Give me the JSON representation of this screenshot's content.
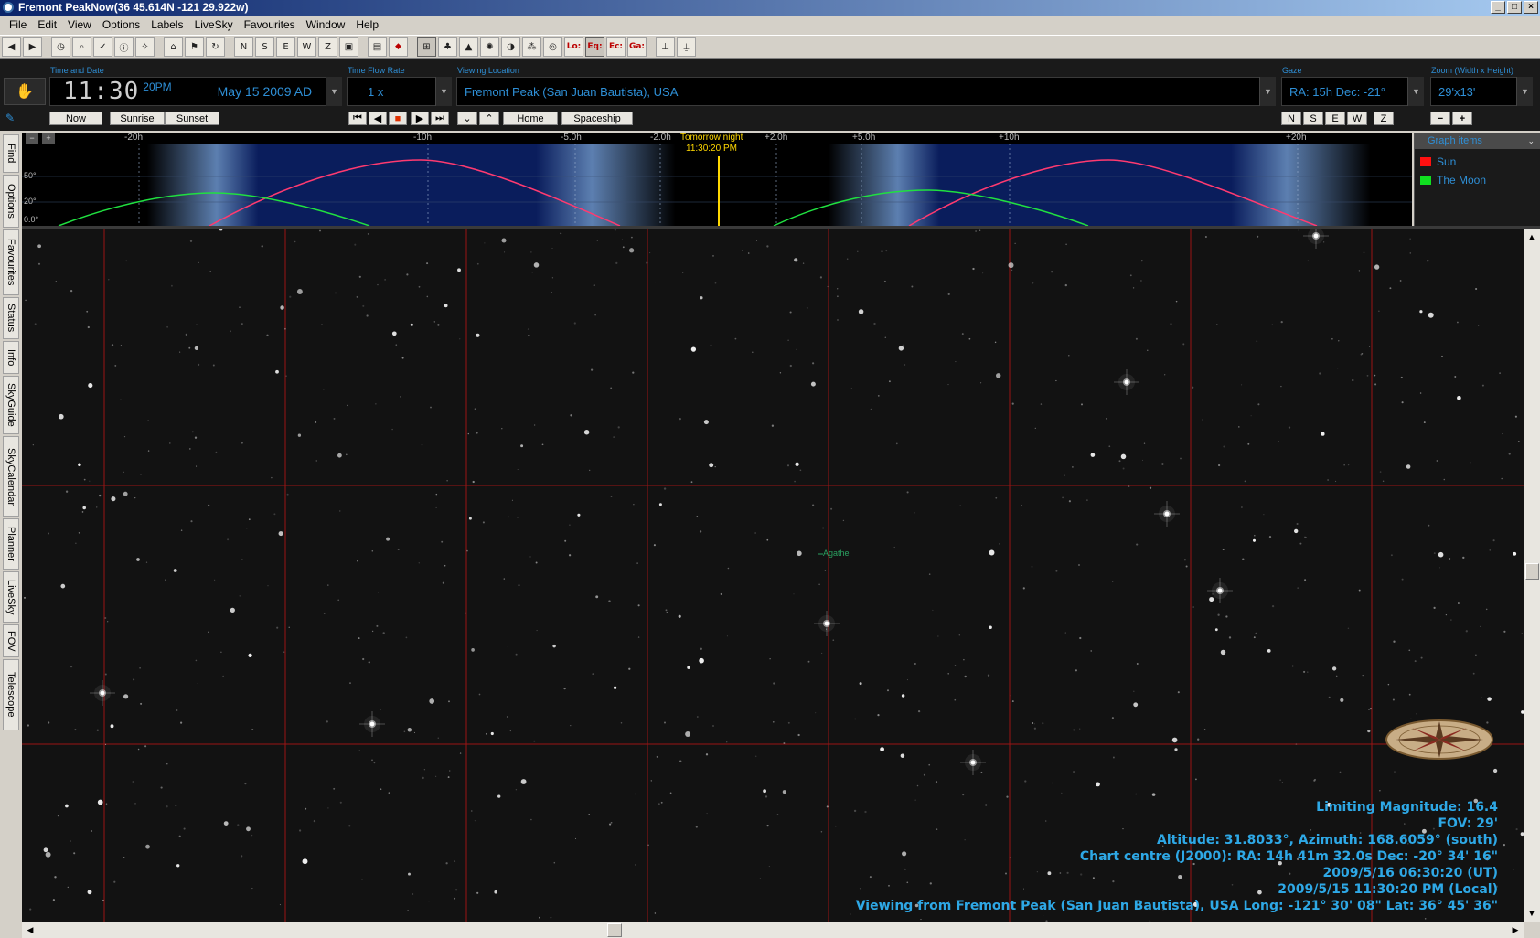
{
  "window": {
    "title": "Fremont PeakNow(36  45.614N -121 29.922w)"
  },
  "menu": [
    "File",
    "Edit",
    "View",
    "Options",
    "Labels",
    "LiveSky",
    "Favourites",
    "Window",
    "Help"
  ],
  "toolbar": {
    "buttons": [
      {
        "icon": "back-arrow-icon",
        "glyph": "◀"
      },
      {
        "icon": "forward-arrow-icon",
        "glyph": "▶"
      },
      {
        "icon": "clock-icon",
        "glyph": "◷"
      },
      {
        "icon": "magnifier-icon",
        "glyph": "⌕"
      },
      {
        "icon": "checklist-icon",
        "glyph": "✓"
      },
      {
        "icon": "info-icon",
        "glyph": "ⓘ"
      },
      {
        "icon": "constellation-icon",
        "glyph": "✧"
      },
      {
        "icon": "home-icon",
        "glyph": "⌂"
      },
      {
        "icon": "flag-icon",
        "glyph": "⚑"
      },
      {
        "icon": "rotate-icon",
        "glyph": "↻"
      }
    ],
    "direction_buttons": [
      "N",
      "S",
      "E",
      "W",
      "Z"
    ],
    "mode_buttons": [
      {
        "icon": "screen-icon",
        "glyph": "▣"
      },
      {
        "icon": "picture-icon",
        "glyph": "▤"
      },
      {
        "icon": "stop-sign-icon",
        "glyph": "◆"
      },
      {
        "icon": "grid-icon",
        "glyph": "⊞"
      },
      {
        "icon": "tree-icon",
        "glyph": "♣"
      },
      {
        "icon": "triangle-icon",
        "glyph": "▲"
      },
      {
        "icon": "sun-icon",
        "glyph": "✺"
      },
      {
        "icon": "globe-icon",
        "glyph": "◑"
      },
      {
        "icon": "asterism-icon",
        "glyph": "⁂"
      },
      {
        "icon": "spiral-icon",
        "glyph": "◎"
      }
    ],
    "grid_labels": [
      "Lo:",
      "Eq:",
      "Ec:",
      "Ga:"
    ],
    "extra_buttons": [
      {
        "icon": "telescope-icon",
        "glyph": "⊥"
      },
      {
        "icon": "telescope-mount-icon",
        "glyph": "⍊"
      }
    ]
  },
  "controls": {
    "time_label": "Time and Date",
    "time": "11:30",
    "ampm": "20PM",
    "date": "May 15   2009 AD",
    "flow_label": "Time Flow Rate",
    "flow": "1 x",
    "location_label": "Viewing Location",
    "location": "Fremont Peak (San Juan Bautista), USA",
    "gaze_label": "Gaze",
    "gaze": "RA: 15h Dec: -21°",
    "zoom_label": "Zoom (Width x Height)",
    "zoom": "29'x13'",
    "now": "Now",
    "sunrise": "Sunrise",
    "sunset": "Sunset",
    "home": "Home",
    "spaceship": "Spaceship",
    "zoom_out": "−",
    "zoom_in": "+"
  },
  "sidetabs": [
    "Find",
    "Options",
    "Favourites",
    "Status",
    "Info",
    "SkyGuide",
    "SkyCalendar",
    "Planner",
    "LiveSky",
    "FOV",
    "Telescope"
  ],
  "timeline": {
    "ticks": [
      "-20h",
      "-10h",
      "-5.0h",
      "-2.0h",
      "+2.0h",
      "+5.0h",
      "+10h",
      "+20h"
    ],
    "alt_labels": [
      "50°",
      "20°",
      "0.0°"
    ],
    "now_label": "Tomorrow night",
    "now_time": "11:30:20 PM",
    "legend_title": "Graph items",
    "legend": [
      {
        "name": "Sun",
        "color": "#ff1010"
      },
      {
        "name": "The Moon",
        "color": "#10e020"
      }
    ]
  },
  "sky": {
    "object_label": "Agathe"
  },
  "info": {
    "lines": [
      "Limiting Magnitude: 16.4",
      "FOV: 29'",
      "Altitude: 31.8033°, Azimuth: 168.6059° (south)",
      "Chart centre (J2000): RA: 14h 41m 32.0s Dec: -20° 34' 16\"",
      "2009/5/16 06:30:20 (UT)",
      "2009/5/15 11:30:20 PM (Local)",
      "Viewing from Fremont Peak (San Juan Bautista), USA    Long: -121° 30' 08\" Lat: 36° 45' 36\""
    ]
  }
}
